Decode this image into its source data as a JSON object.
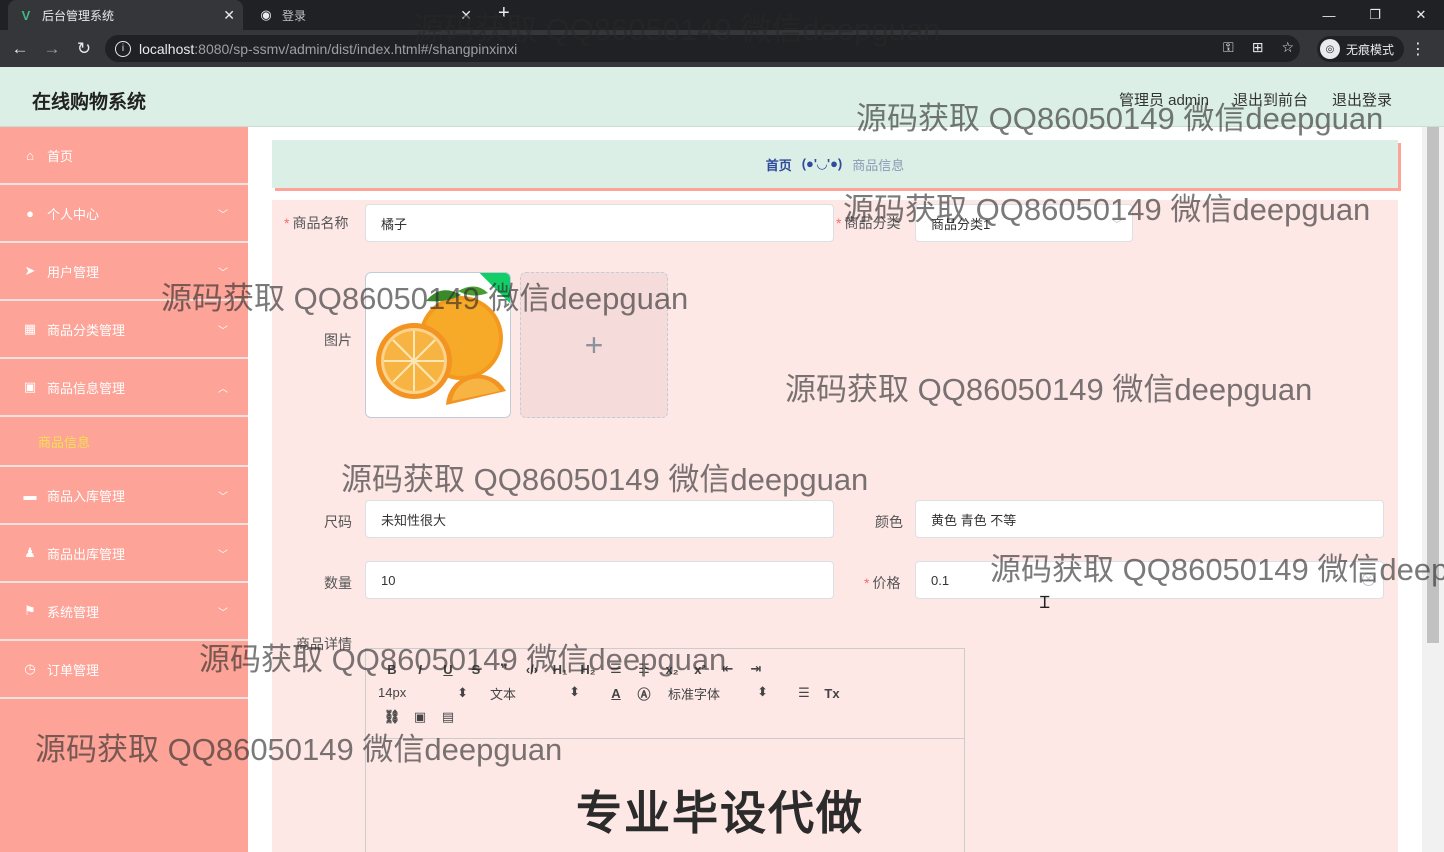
{
  "browser": {
    "active_tab_title": "后台管理系统",
    "inactive_tab_title": "登录",
    "url_host": "localhost",
    "url_rest": ":8080/sp-ssmv/admin/dist/index.html#/shangpinxinxi",
    "incognito_label": "无痕模式"
  },
  "header": {
    "app_title": "在线购物系统",
    "admin_label": "管理员 admin",
    "to_front_label": "退出到前台",
    "logout_label": "退出登录"
  },
  "sidebar": {
    "items": [
      {
        "label": "首页",
        "icon": "home-icon"
      },
      {
        "label": "个人中心",
        "icon": "user-icon"
      },
      {
        "label": "用户管理",
        "icon": "send-icon"
      },
      {
        "label": "商品分类管理",
        "icon": "grid-icon"
      },
      {
        "label": "商品信息管理",
        "icon": "box-icon"
      },
      {
        "label": "商品信息",
        "icon": ""
      },
      {
        "label": "商品入库管理",
        "icon": "ticket-icon"
      },
      {
        "label": "商品出库管理",
        "icon": "person-icon"
      },
      {
        "label": "系统管理",
        "icon": "flag-icon"
      },
      {
        "label": "订单管理",
        "icon": "clock-icon"
      }
    ]
  },
  "breadcrumb": {
    "home": "首页",
    "separator": "(●'◡'●)",
    "current": "商品信息"
  },
  "form": {
    "name_label": "商品名称",
    "name_value": "橘子",
    "category_label": "商品分类",
    "category_value": "商品分类1",
    "image_label": "图片",
    "size_label": "尺码",
    "size_value": "未知性很大",
    "color_label": "颜色",
    "color_value": "黄色 青色 不等",
    "qty_label": "数量",
    "qty_value": "10",
    "price_label": "价格",
    "price_value": "0.1",
    "detail_label": "商品详情",
    "upload_plus": "+"
  },
  "editor": {
    "font_size": "14px",
    "format": "文本",
    "font_family": "标准字体",
    "content": "专业毕设代做"
  },
  "watermark": "源码获取 QQ86050149 微信deepguan"
}
